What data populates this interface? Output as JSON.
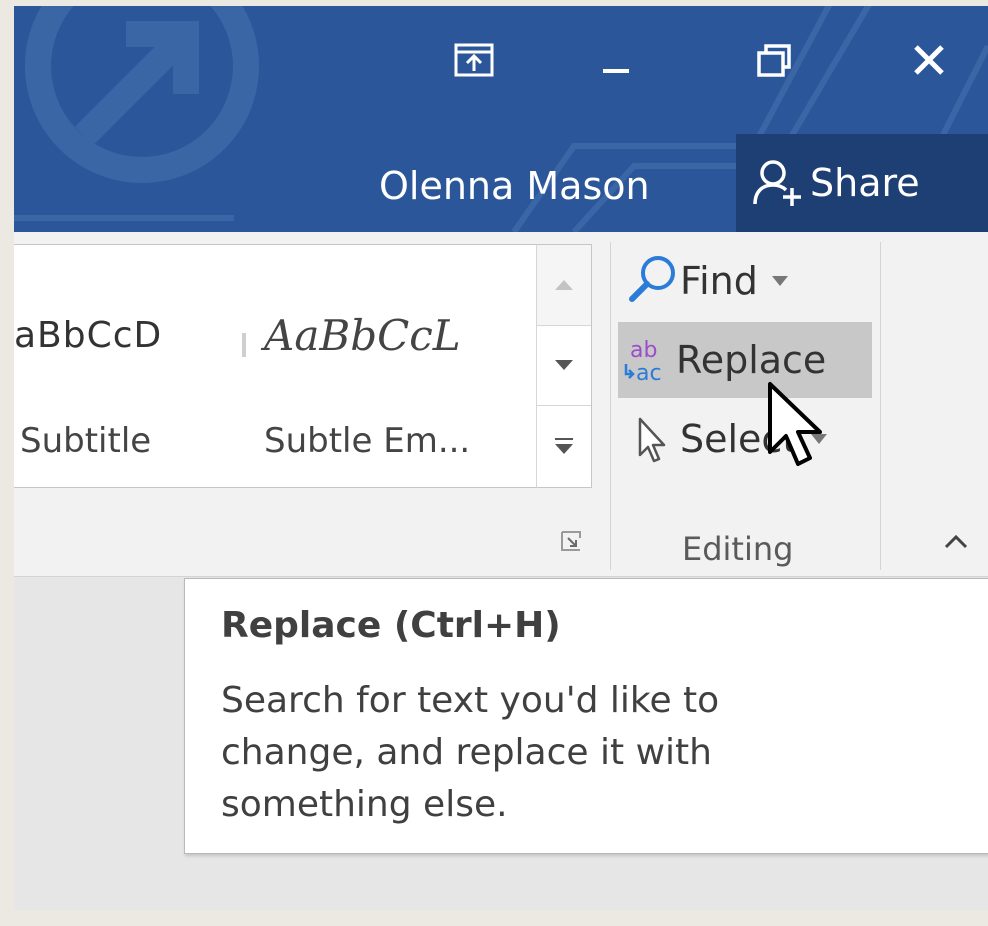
{
  "titlebar": {
    "ribbon_display_icon": "ribbon-display-options-icon",
    "minimize_icon": "minimize-icon",
    "restore_icon": "restore-icon",
    "close_icon": "close-icon",
    "user_name": "Olenna Mason",
    "share_label": "Share",
    "share_icon": "share-person-icon",
    "background_color": "#2b579a",
    "share_background": "#1e3f74"
  },
  "styles_gallery": {
    "items": [
      {
        "sample": "aBbCcD",
        "name": "Subtitle"
      },
      {
        "sample": "AaBbCcL",
        "name": "Subtle Em..."
      }
    ],
    "scroll_up_icon": "scroll-up-icon",
    "scroll_down_icon": "scroll-down-icon",
    "more_icon": "gallery-more-icon",
    "launcher_icon": "dialog-launcher-icon"
  },
  "editing": {
    "group_label": "Editing",
    "find": {
      "label": "Find",
      "icon": "search-icon"
    },
    "replace": {
      "label": "Replace",
      "icon": "replace-icon",
      "hovered": true
    },
    "select": {
      "label": "Select",
      "icon": "select-pointer-icon"
    },
    "collapse_icon": "chevron-up-icon"
  },
  "tooltip": {
    "title": "Replace (Ctrl+H)",
    "body": "Search for text you'd like to change, and replace it with something else."
  },
  "colors": {
    "accent": "#2b579a",
    "replace_icon_purple": "#9b4dca",
    "replace_icon_blue": "#2b7bd8",
    "hover_bg": "#c8c8c8"
  }
}
